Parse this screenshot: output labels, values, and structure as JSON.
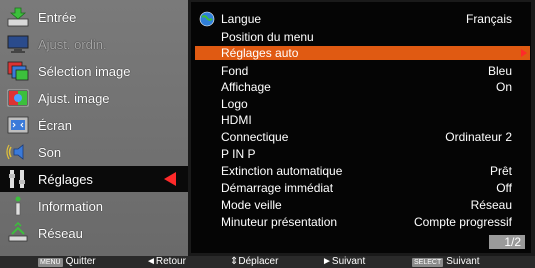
{
  "sidebar": {
    "items": [
      {
        "label": "Entrée",
        "icon": "input-icon"
      },
      {
        "label": "Ajust. ordin.",
        "icon": "computer-adjust-icon"
      },
      {
        "label": "Sélection image",
        "icon": "image-select-icon"
      },
      {
        "label": "Ajust. image",
        "icon": "image-adjust-icon"
      },
      {
        "label": "Écran",
        "icon": "screen-icon"
      },
      {
        "label": "Son",
        "icon": "sound-icon"
      },
      {
        "label": "Réglages",
        "icon": "settings-icon"
      },
      {
        "label": "Information",
        "icon": "info-icon"
      },
      {
        "label": "Réseau",
        "icon": "network-icon"
      }
    ]
  },
  "panel": {
    "rows": [
      {
        "label": "Langue",
        "value": "Français"
      },
      {
        "label": "Position du menu",
        "value": ""
      },
      {
        "label": "Réglages auto",
        "value": ""
      },
      {
        "label": "Fond",
        "value": "Bleu"
      },
      {
        "label": "Affichage",
        "value": "On"
      },
      {
        "label": "Logo",
        "value": ""
      },
      {
        "label": "HDMI",
        "value": ""
      },
      {
        "label": "Connectique",
        "value": "Ordinateur 2"
      },
      {
        "label": "P IN P",
        "value": ""
      },
      {
        "label": "Extinction automatique",
        "value": "Prêt"
      },
      {
        "label": "Démarrage immédiat",
        "value": "Off"
      },
      {
        "label": "Mode veille",
        "value": "Réseau"
      },
      {
        "label": "Minuteur présentation",
        "value": "Compte progressif"
      }
    ],
    "page": "1/2"
  },
  "bottombar": {
    "menu_key": "MENU",
    "quit": "Quitter",
    "back": "◄Retour",
    "move": "⇕Déplacer",
    "next": "►Suivant",
    "select_key": "SELECT",
    "next2": "Suivant"
  },
  "colors": {
    "highlight": "#e05a12",
    "arrow": "#ff2a2a"
  }
}
